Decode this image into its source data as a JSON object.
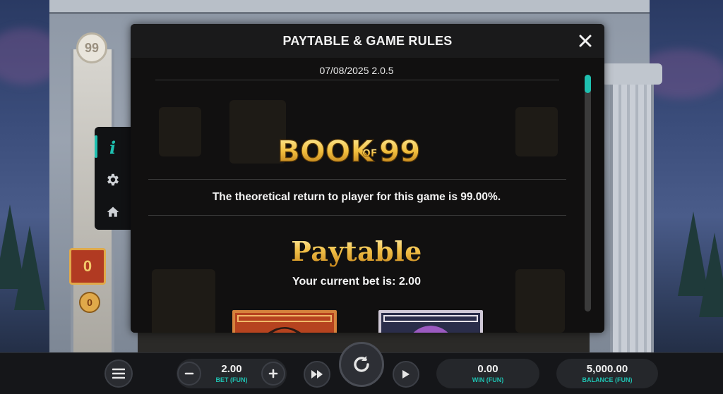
{
  "dialog": {
    "title": "PAYTABLE & GAME RULES",
    "version": "07/08/2025 2.0.5",
    "logo_text": "BOOK of 99",
    "rtp_text": "The theoretical return to player for this game is 99.00%.",
    "paytable_heading": "Paytable",
    "current_bet_text": "Your current bet is: 2.00",
    "scroll_position": 0
  },
  "side_menu": {
    "items": [
      {
        "name": "info",
        "icon": "info-icon",
        "active": true
      },
      {
        "name": "settings",
        "icon": "gear-icon",
        "active": false
      },
      {
        "name": "home",
        "icon": "home-icon",
        "active": false
      }
    ]
  },
  "background": {
    "emblem_text": "99",
    "box_text": "0",
    "coin_text": "0"
  },
  "bottom_bar": {
    "bet": {
      "value": "2.00",
      "label": "BET (FUN)"
    },
    "win": {
      "value": "0.00",
      "label": "WIN (FUN)"
    },
    "balance": {
      "value": "5,000.00",
      "label": "BALANCE (FUN)"
    },
    "icons": {
      "menu": "hamburger-menu-icon",
      "minus": "minus-icon",
      "plus": "plus-icon",
      "turbo": "fast-forward-icon",
      "spin": "spin-icon",
      "autoplay": "play-icon"
    }
  },
  "colors": {
    "accent": "#1fc0b0",
    "gold": "#f3c24a",
    "modal_bg": "#0d0d0e"
  }
}
